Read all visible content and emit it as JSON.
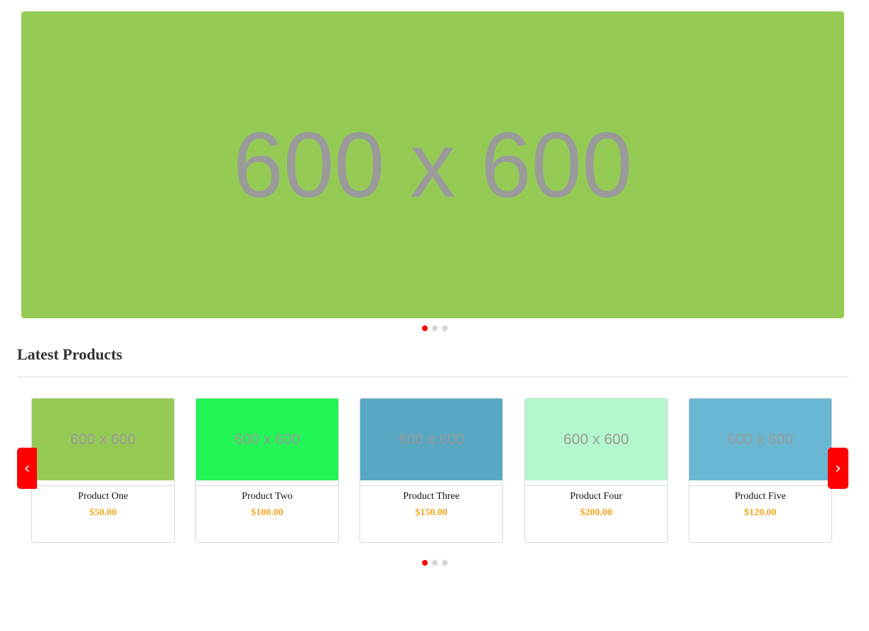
{
  "hero": {
    "image_text": "600 x 600",
    "color": "#95cb55",
    "dots": [
      {
        "active": true
      },
      {
        "active": false
      },
      {
        "active": false
      }
    ]
  },
  "section": {
    "title": "Latest Products"
  },
  "carousel": {
    "prev_label": "‹",
    "next_label": "›",
    "products": [
      {
        "image_text": "600 x 600",
        "color": "#95cb55",
        "name": "Product One",
        "price": "$50.00"
      },
      {
        "image_text": "600 x 600",
        "color": "#22f556",
        "name": "Product Two",
        "price": "$100.00"
      },
      {
        "image_text": "600 x 600",
        "color": "#58a8c4",
        "name": "Product Three",
        "price": "$150.00"
      },
      {
        "image_text": "600 x 600",
        "color": "#b3f7cc",
        "name": "Product Four",
        "price": "$200.00"
      },
      {
        "image_text": "600 x 600",
        "color": "#69b7d3",
        "name": "Product Five",
        "price": "$120.00"
      }
    ],
    "dots": [
      {
        "active": true
      },
      {
        "active": false
      },
      {
        "active": false
      }
    ]
  },
  "colors": {
    "accent": "#ff0000",
    "price": "#f5a623"
  }
}
